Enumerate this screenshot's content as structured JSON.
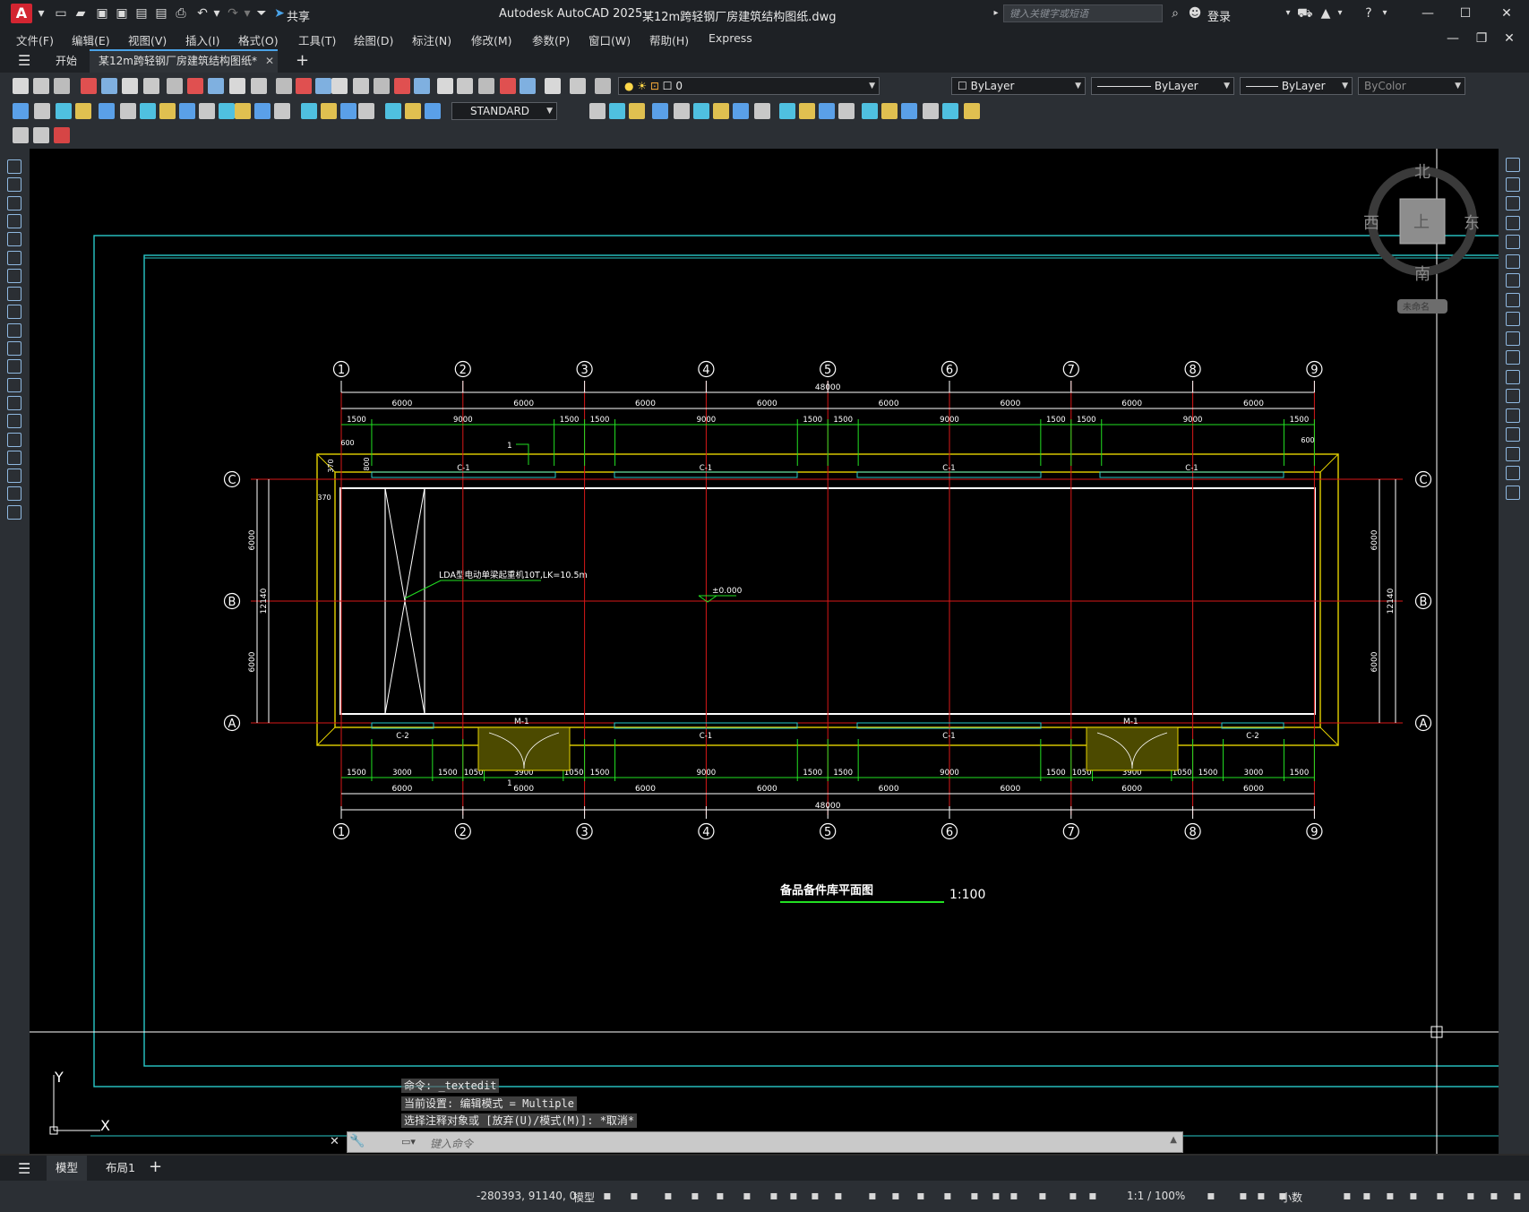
{
  "titlebar": {
    "app_logo": "A",
    "share_label": "共享",
    "title": "Autodesk AutoCAD 2025",
    "filename": "某12m跨轻钢厂房建筑结构图纸.dwg",
    "search_placeholder": "键入关键字或短语",
    "login_label": "登录"
  },
  "menu": [
    "文件(F)",
    "编辑(E)",
    "视图(V)",
    "插入(I)",
    "格式(O)",
    "工具(T)",
    "绘图(D)",
    "标注(N)",
    "修改(M)",
    "参数(P)",
    "窗口(W)",
    "帮助(H)",
    "Express"
  ],
  "tabs": {
    "start": "开始",
    "document": "某12m跨轻钢厂房建筑结构图纸*"
  },
  "toolbar": {
    "layer_value": "0",
    "color_value": "ByLayer",
    "linetype_value": "ByLayer",
    "lineweight_value": "ByLayer",
    "plotstyle_value": "ByColor",
    "dimstyle_value": "STANDARD"
  },
  "viewcube": {
    "north": "北",
    "south": "南",
    "east": "东",
    "west": "西",
    "top": "上",
    "wcs": "未命名"
  },
  "drawing": {
    "axis_numbers": [
      "1",
      "2",
      "3",
      "4",
      "5",
      "6",
      "7",
      "8",
      "9"
    ],
    "axis_letters": [
      "C",
      "B",
      "A"
    ],
    "bay_dims": [
      "6000",
      "6000",
      "6000",
      "6000",
      "6000",
      "6000",
      "6000",
      "6000"
    ],
    "total_dim": "48000",
    "top_sub_dims": [
      "1500",
      "9000",
      "1500",
      "1500",
      "9000",
      "1500",
      "1500",
      "9000",
      "1500",
      "1500",
      "9000",
      "1500"
    ],
    "bottom_sub_dims": [
      "1500",
      "3000",
      "1500",
      "1050",
      "3900",
      "1050",
      "1500",
      "9000",
      "1500",
      "1500",
      "9000",
      "1500",
      "1050",
      "3900",
      "1050",
      "1500",
      "3000",
      "1500"
    ],
    "side_dims": [
      "6000",
      "6000"
    ],
    "side_total": "12140",
    "small_dims": [
      "600",
      "370",
      "800",
      "370",
      "600"
    ],
    "window_top": [
      "C-1",
      "C-1",
      "C-1",
      "C-1"
    ],
    "window_bottom": [
      "C-2",
      "C-1",
      "C-1",
      "C-2"
    ],
    "doors": [
      "M-1",
      "M-1"
    ],
    "crane_label": "LDA型电动单梁起重机10T,LK=10.5m",
    "elevation": "±0.000",
    "marker": "1",
    "drawing_title": "备品备件库平面图",
    "scale": "1:100"
  },
  "ucs": {
    "y": "Y",
    "x": "X"
  },
  "command": {
    "line1": "命令: _textedit",
    "line2": "当前设置: 编辑模式 = Multiple",
    "line3": "选择注释对象或 [放弃(U)/模式(M)]: *取消*",
    "input_placeholder": "键入命令"
  },
  "layout_tabs": [
    "模型",
    "布局1"
  ],
  "status": {
    "coords": "-280393, 91140, 0",
    "model": "模型",
    "scale": "1:1 / 100%",
    "units": "小数"
  }
}
